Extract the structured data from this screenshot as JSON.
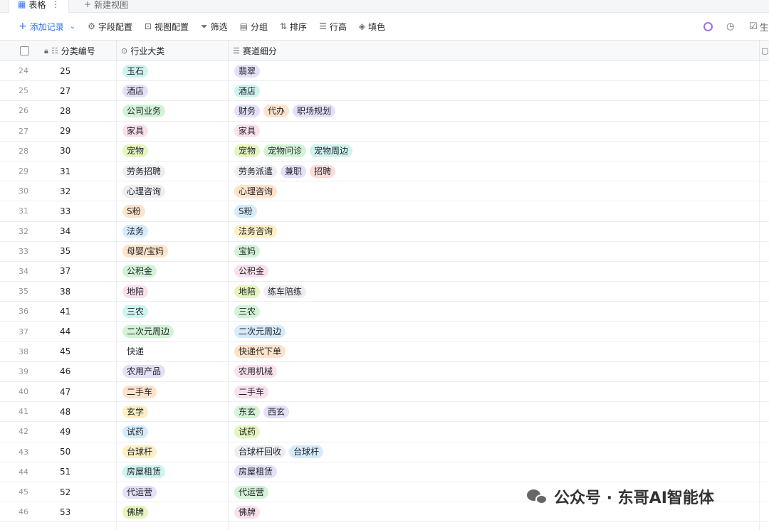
{
  "tabs": [
    {
      "label": "表格",
      "icon": "grid-icon",
      "active": true
    },
    {
      "label": "新建视图",
      "icon": "plus-icon",
      "active": false
    }
  ],
  "toolbar": {
    "add_record": "添加记录",
    "field_config": "字段配置",
    "view_config": "视图配置",
    "filter": "筛选",
    "group": "分组",
    "sort": "排序",
    "row_height": "行高",
    "fill": "填色",
    "right_text": "生"
  },
  "columns": [
    {
      "label": "分类编号",
      "icon": "list-number-icon"
    },
    {
      "label": "行业大类",
      "icon": "single-select-icon"
    },
    {
      "label": "赛道细分",
      "icon": "multi-select-icon"
    }
  ],
  "colors": {
    "accent": "#3370ff",
    "tag_green": "#d3f3d6",
    "tag_teal": "#cff3ee",
    "tag_lime": "#e4f5bd",
    "tag_blue": "#d6ebfa",
    "tag_purple": "#e3e0f7",
    "tag_pink": "#f9e0ec",
    "tag_orange": "#fde3cb",
    "tag_yellow": "#fcefc4",
    "tag_gray": "#eceef1",
    "tag_red": "#fbdcd9"
  },
  "rows": [
    {
      "index": "24",
      "code": "25",
      "category": {
        "label": "玉石",
        "color": "#cff3ee"
      },
      "subs": [
        {
          "label": "翡翠",
          "color": "#e3e0f7"
        }
      ]
    },
    {
      "index": "25",
      "code": "27",
      "category": {
        "label": "酒店",
        "color": "#e3e0f7"
      },
      "subs": [
        {
          "label": "酒店",
          "color": "#cff3ee"
        }
      ]
    },
    {
      "index": "26",
      "code": "28",
      "category": {
        "label": "公司业务",
        "color": "#d3f3d6"
      },
      "subs": [
        {
          "label": "财务",
          "color": "#e3e0f7"
        },
        {
          "label": "代办",
          "color": "#fde3cb"
        },
        {
          "label": "职场规划",
          "color": "#e3e0f7"
        }
      ]
    },
    {
      "index": "27",
      "code": "29",
      "category": {
        "label": "家具",
        "color": "#f9e0ec"
      },
      "subs": [
        {
          "label": "家具",
          "color": "#f9e0ec"
        }
      ]
    },
    {
      "index": "28",
      "code": "30",
      "category": {
        "label": "宠物",
        "color": "#e4f5bd"
      },
      "subs": [
        {
          "label": "宠物",
          "color": "#e4f5bd"
        },
        {
          "label": "宠物问诊",
          "color": "#d3f3d6"
        },
        {
          "label": "宠物周边",
          "color": "#cff3ee"
        }
      ]
    },
    {
      "index": "29",
      "code": "31",
      "category": {
        "label": "劳务招聘",
        "color": "#eceef1"
      },
      "subs": [
        {
          "label": "劳务派遣",
          "color": "#eceef1"
        },
        {
          "label": "兼职",
          "color": "#e3e0f7"
        },
        {
          "label": "招聘",
          "color": "#fbdcd9"
        }
      ]
    },
    {
      "index": "30",
      "code": "32",
      "category": {
        "label": "心理咨询",
        "color": "#eceef1"
      },
      "subs": [
        {
          "label": "心理咨询",
          "color": "#fde3cb"
        }
      ]
    },
    {
      "index": "31",
      "code": "33",
      "category": {
        "label": "S粉",
        "color": "#fde3cb"
      },
      "subs": [
        {
          "label": "S粉",
          "color": "#d6ebfa"
        }
      ]
    },
    {
      "index": "32",
      "code": "34",
      "category": {
        "label": "法务",
        "color": "#d6ebfa"
      },
      "subs": [
        {
          "label": "法务咨询",
          "color": "#fcefc4"
        }
      ]
    },
    {
      "index": "33",
      "code": "35",
      "category": {
        "label": "母婴/宝妈",
        "color": "#fde3cb"
      },
      "subs": [
        {
          "label": "宝妈",
          "color": "#d3f3d6"
        }
      ]
    },
    {
      "index": "34",
      "code": "37",
      "category": {
        "label": "公积金",
        "color": "#d3f3d6"
      },
      "subs": [
        {
          "label": "公积金",
          "color": "#f9e0ec"
        }
      ]
    },
    {
      "index": "35",
      "code": "38",
      "category": {
        "label": "地陪",
        "color": "#f9e0ec"
      },
      "subs": [
        {
          "label": "地陪",
          "color": "#e4f5bd"
        },
        {
          "label": "练车陪练",
          "color": "#eceef1"
        }
      ]
    },
    {
      "index": "36",
      "code": "41",
      "category": {
        "label": "三农",
        "color": "#cff3ee"
      },
      "subs": [
        {
          "label": "三农",
          "color": "#d3f3d6"
        }
      ]
    },
    {
      "index": "37",
      "code": "44",
      "category": {
        "label": "二次元周边",
        "color": "#d3f3d6"
      },
      "subs": [
        {
          "label": "二次元周边",
          "color": "#d6ebfa"
        }
      ]
    },
    {
      "index": "38",
      "code": "45",
      "category": {
        "label": "快递",
        "color": "#ffffff"
      },
      "subs": [
        {
          "label": "快递代下单",
          "color": "#fde3cb"
        }
      ]
    },
    {
      "index": "39",
      "code": "46",
      "category": {
        "label": "农用产品",
        "color": "#e3e0f7"
      },
      "subs": [
        {
          "label": "农用机械",
          "color": "#f9e0ec"
        }
      ]
    },
    {
      "index": "40",
      "code": "47",
      "category": {
        "label": "二手车",
        "color": "#fde3cb"
      },
      "subs": [
        {
          "label": "二手车",
          "color": "#f9e0ec"
        }
      ]
    },
    {
      "index": "41",
      "code": "48",
      "category": {
        "label": "玄学",
        "color": "#fcefc4"
      },
      "subs": [
        {
          "label": "东玄",
          "color": "#d3f3d6"
        },
        {
          "label": "西玄",
          "color": "#e3e0f7"
        }
      ]
    },
    {
      "index": "42",
      "code": "49",
      "category": {
        "label": "试药",
        "color": "#d6ebfa"
      },
      "subs": [
        {
          "label": "试药",
          "color": "#e4f5bd"
        }
      ]
    },
    {
      "index": "43",
      "code": "50",
      "category": {
        "label": "台球杆",
        "color": "#fcefc4"
      },
      "subs": [
        {
          "label": "台球杆回收",
          "color": "#eceef1"
        },
        {
          "label": "台球杆",
          "color": "#d6ebfa"
        }
      ]
    },
    {
      "index": "44",
      "code": "51",
      "category": {
        "label": "房屋租赁",
        "color": "#cff3ee"
      },
      "subs": [
        {
          "label": "房屋租赁",
          "color": "#e3e0f7"
        }
      ]
    },
    {
      "index": "45",
      "code": "52",
      "category": {
        "label": "代运营",
        "color": "#e3e0f7"
      },
      "subs": [
        {
          "label": "代运营",
          "color": "#d3f3d6"
        }
      ]
    },
    {
      "index": "46",
      "code": "53",
      "category": {
        "label": "佛牌",
        "color": "#e4f5bd"
      },
      "subs": [
        {
          "label": "佛牌",
          "color": "#f9e0ec"
        }
      ]
    }
  ],
  "watermark": "公众号 · 东哥AI智能体"
}
